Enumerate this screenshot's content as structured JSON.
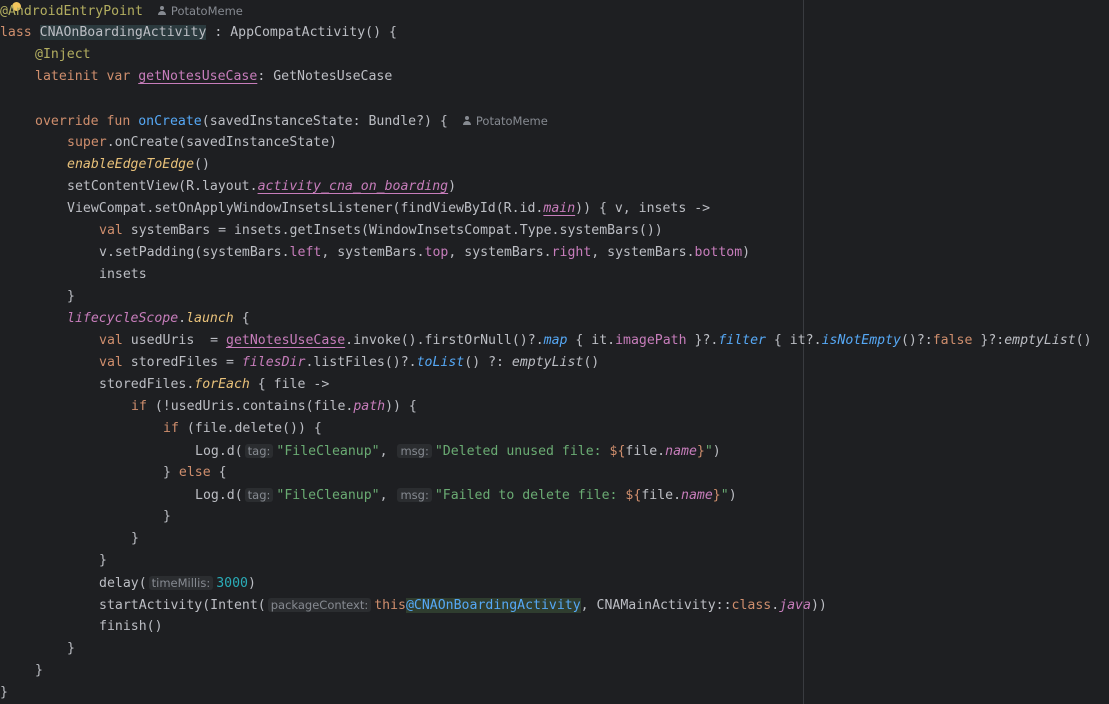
{
  "file": {
    "annotation_line": "@AndroidEntryPoint",
    "author": "PotatoMeme",
    "class_kw": "class",
    "class_name": "CNAOnBoardingActivity",
    "class_rest": " : AppCompatActivity() {",
    "inject": "@Inject",
    "lateinit_kw": "lateinit var ",
    "use_case_var": "getNotesUseCase",
    "use_case_type": ": GetNotesUseCase",
    "override_kw": "override fun ",
    "on_create": "onCreate",
    "on_create_params": "(savedInstanceState: Bundle?) {",
    "super_kw": "super",
    "super_call": ".onCreate(savedInstanceState)",
    "edge": "enableEdgeToEdge",
    "edge_parens": "()",
    "set_content": "setContentView(R.layout.",
    "layout_name": "activity_cna_on_boarding",
    "close_paren": ")",
    "view_compat": "ViewCompat.setOnApplyWindowInsetsListener(findViewById(R.id.",
    "main_id": "main",
    "view_compat_rest": ")) { v, insets ->",
    "val_kw": "val ",
    "system_bars_decl": "systemBars = insets.getInsets(WindowInsetsCompat.Type.systemBars())",
    "set_padding_a": "v.setPadding(systemBars.",
    "left": "left",
    "sep_sb": ", systemBars.",
    "top": "top",
    "right": "right",
    "bottom": "bottom",
    "insets": "insets",
    "close_brace": "}",
    "lifecycle_scope": "lifecycleScope",
    "dot": ".",
    "launch": "launch",
    "open_brace": " {",
    "used_uris_a": "usedUris  = ",
    "invoke_chain": ".invoke().firstOrNull()?.",
    "map": "map",
    "it_image": " { it.",
    "image_path": "imagePath",
    "after_image": " }?.",
    "filter": "filter",
    "it_q": " { it?.",
    "is_not_empty": "isNotEmpty",
    "not_empty_tail": "()?:",
    "false_kw": "false",
    "tail_a": " }?:",
    "empty_list": "emptyList",
    "parens": "()",
    "stored_files_a": "storedFiles = ",
    "files_dir": "filesDir",
    "list_files": ".listFiles()?.",
    "to_list": "toList",
    "elvis": "() ?: ",
    "stored_files_b": "storedFiles.",
    "for_each": "forEach",
    "file_lambda": " { file ->",
    "if_kw": "if",
    "if_cond_a": " (!usedUris.contains(file.",
    "path": "path",
    "if_cond_b": ")) {",
    "if_delete": " (file.delete()) {",
    "log_d": "Log.d(",
    "hint_tag": "tag:",
    "str_tag": "\"FileCleanup\"",
    "comma": ", ",
    "hint_msg": "msg:",
    "str_deleted": "\"Deleted unused file: ",
    "template_open": "${",
    "file_ref": "file.",
    "name": "name",
    "template_close": "}",
    "quote": "\"",
    "else_open": "} ",
    "else_kw": "else",
    "str_failed": "\"Failed to delete file: ",
    "delay": "delay(",
    "hint_time": "timeMillis:",
    "delay_num": "3000",
    "start_activity": "startActivity(Intent(",
    "hint_pkg": "packageContext:",
    "this_kw": "this",
    "at_label": "@CNAOnBoardingActivity",
    "main_activity": ", CNAMainActivity::",
    "class_word": "class",
    "java": "java",
    "double_close": "))",
    "finish": "finish()"
  },
  "colors": {
    "background": "#1e1f22",
    "keyword": "#cf8e6d",
    "function": "#56a8f5",
    "string": "#6aab73",
    "number": "#2aacb8",
    "property": "#c77dbb",
    "annotation": "#b3ae60"
  }
}
